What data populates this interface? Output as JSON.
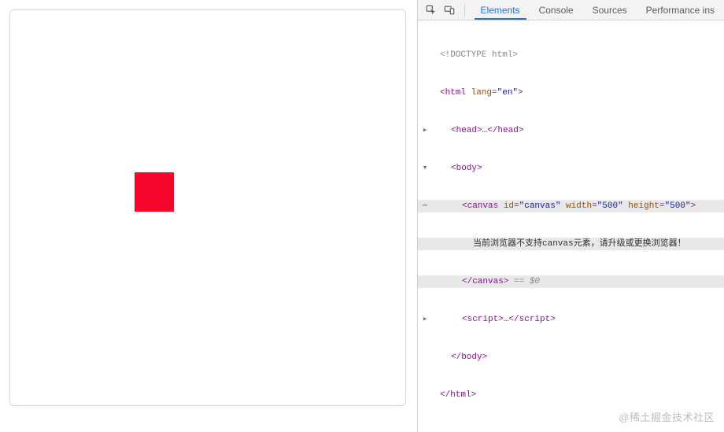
{
  "devtools": {
    "tabs": [
      "Elements",
      "Console",
      "Sources",
      "Performance ins"
    ],
    "activeTab": 0
  },
  "dom": {
    "doctype": "<!DOCTYPE html>",
    "html_open": "<html ",
    "html_lang_attr": "lang",
    "html_lang_val": "\"en\"",
    "html_close_gt": ">",
    "head_open": "<head>",
    "ellipsis": "…",
    "head_close": "</head>",
    "body_open": "<body>",
    "canvas_open": "<canvas ",
    "canvas_id_attr": "id",
    "canvas_id_val": "\"canvas\"",
    "canvas_w_attr": "width",
    "canvas_w_val": "\"500\"",
    "canvas_h_attr": "height",
    "canvas_h_val": "\"500\"",
    "gt": ">",
    "canvas_text": "当前浏览器不支持canvas元素，请升级或更换浏览器！",
    "canvas_close": "</canvas>",
    "eq_dollar": " == $0",
    "script_open": "<script>",
    "script_close_tag": "</script>",
    "body_close": "</body>",
    "html_close": "</html>",
    "gutter_dots": "⋯"
  },
  "watermark": "@稀土掘金技术社区"
}
